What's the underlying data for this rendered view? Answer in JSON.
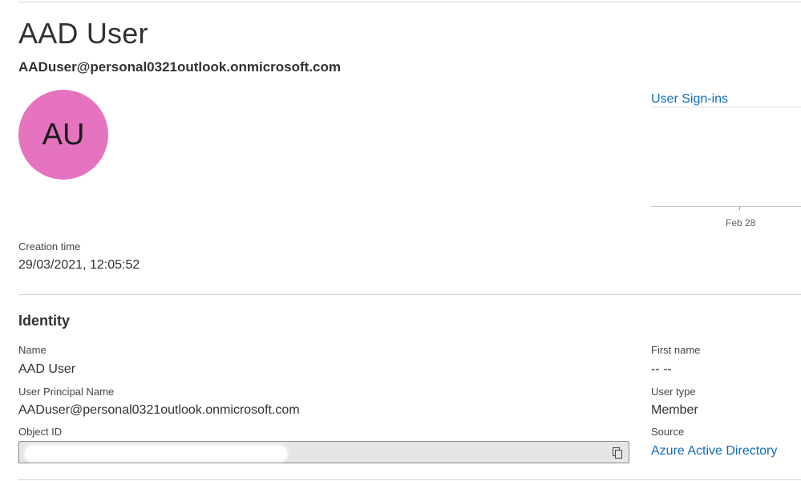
{
  "header": {
    "title": "AAD User",
    "upn": "AADuser@personal0321outlook.onmicrosoft.com"
  },
  "avatar": {
    "initials": "AU",
    "color": "#e673c0"
  },
  "signins": {
    "link_label": "User Sign-ins",
    "tick_label": "Feb 28"
  },
  "creation": {
    "label": "Creation time",
    "value": "29/03/2021, 12:05:52"
  },
  "identity": {
    "heading": "Identity",
    "name_label": "Name",
    "name_value": "AAD User",
    "upn_label": "User Principal Name",
    "upn_value": "AADuser@personal0321outlook.onmicrosoft.com",
    "objectid_label": "Object ID",
    "firstname_label": "First name",
    "firstname_value": "-- --",
    "usertype_label": "User type",
    "usertype_value": "Member",
    "source_label": "Source",
    "source_value": "Azure Active Directory"
  },
  "icons": {
    "copy": "copy-icon"
  },
  "colors": {
    "link": "#0f6cbd",
    "avatar": "#e673c0"
  }
}
